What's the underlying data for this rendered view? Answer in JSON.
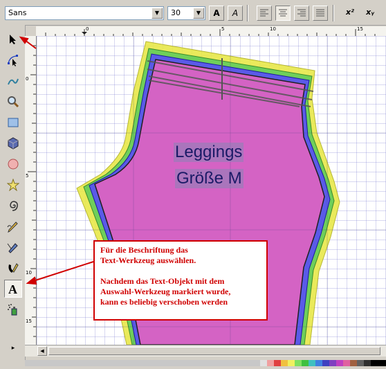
{
  "toolbar": {
    "font_family": "Sans",
    "font_size": "30",
    "bold_label": "A",
    "italic_label": "A",
    "superscript_label": "x²",
    "subscript_label": "xᵧ"
  },
  "ruler": {
    "h_ticks": [
      "0",
      "5",
      "10",
      "15"
    ],
    "v_ticks": [
      "0",
      "5",
      "10",
      "15"
    ]
  },
  "canvas": {
    "line1": "Leggings",
    "line2": "Größe M"
  },
  "callout": {
    "line1": "Für die Beschriftung das",
    "line2": "Text-Werkzeug auswählen.",
    "line3": "Nachdem das Text-Objekt mit dem",
    "line4": "Auswahl-Werkzeug markiert wurde,",
    "line5": "kann es beliebig verschoben werden"
  },
  "colors": {
    "callout_border": "#d00000",
    "arrow": "#d00000",
    "pattern_yellow": "#e8e84a",
    "pattern_green": "#6fcf5a",
    "pattern_blue": "#5a5ae8",
    "pattern_magenta": "#d463c4"
  }
}
